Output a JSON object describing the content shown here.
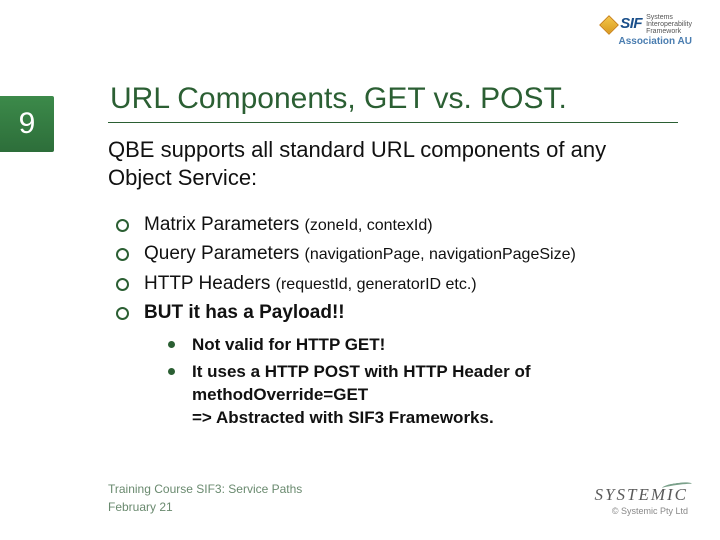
{
  "header": {
    "logo_brand": "SIF",
    "logo_sub1": "Systems",
    "logo_sub2": "Interoperability",
    "logo_sub3": "Framework",
    "association": "Association AU"
  },
  "page_number": "9",
  "title": "URL Components, GET vs. POST.",
  "lead": "QBE supports all standard URL components of any Object Service:",
  "bullets": [
    {
      "label": "Matrix Parameters ",
      "params": "(zoneId, contexId)"
    },
    {
      "label": "Query Parameters ",
      "params": "(navigationPage, navigationPageSize)"
    },
    {
      "label": "HTTP Headers ",
      "params": "(requestId, generatorID etc.)"
    },
    {
      "label": "BUT it has a Payload!!",
      "params": ""
    }
  ],
  "subbullets": [
    "Not valid for HTTP GET!",
    "It uses a HTTP POST with HTTP Header of methodOverride=GET\n=> Abstracted with SIF3 Frameworks."
  ],
  "footer": {
    "line1": "Training Course SIF3: Service Paths",
    "line2": "February 21",
    "brand": "SYSTEMIC",
    "copyright": "© Systemic Pty Ltd"
  }
}
